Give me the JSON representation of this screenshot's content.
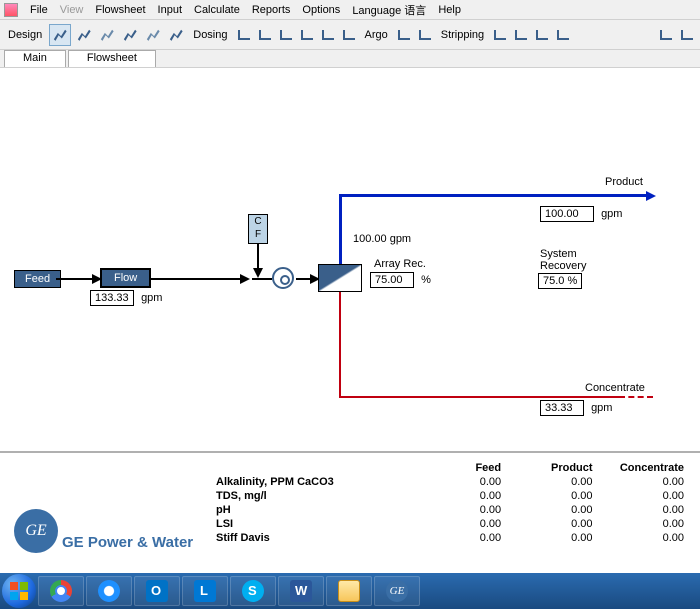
{
  "menu": {
    "file": "File",
    "view": "View",
    "flowsheet": "Flowsheet",
    "input": "Input",
    "calculate": "Calculate",
    "reports": "Reports",
    "options": "Options",
    "language": "Language 语言",
    "help": "Help"
  },
  "toolbar": {
    "design": "Design",
    "dosing": "Dosing",
    "argo": "Argo",
    "stripping": "Stripping"
  },
  "tabs": {
    "main": "Main",
    "flowsheet": "Flowsheet"
  },
  "flowsheet": {
    "feed_label": "Feed",
    "flow_label": "Flow",
    "flow_value": "133.33",
    "flow_unit": "gpm",
    "cf_label_1": "C",
    "cf_label_2": "F",
    "feed_to_membrane": "100.00 gpm",
    "array_rec_label": "Array Rec.",
    "array_rec_value": "75.00",
    "array_rec_unit": "%",
    "product_label": "Product",
    "product_value": "100.00",
    "product_unit": "gpm",
    "system_recovery_label1": "System",
    "system_recovery_label2": "Recovery",
    "system_recovery_value": "75.0 %",
    "concentrate_label": "Concentrate",
    "concentrate_value": "33.33",
    "concentrate_unit": "gpm"
  },
  "table": {
    "headers": {
      "feed": "Feed",
      "product": "Product",
      "concentrate": "Concentrate"
    },
    "rows": [
      {
        "label": "Alkalinity, PPM CaCO3",
        "feed": "0.00",
        "product": "0.00",
        "concentrate": "0.00"
      },
      {
        "label": "TDS, mg/l",
        "feed": "0.00",
        "product": "0.00",
        "concentrate": "0.00"
      },
      {
        "label": "pH",
        "feed": "0.00",
        "product": "0.00",
        "concentrate": "0.00"
      },
      {
        "label": "LSI",
        "feed": "0.00",
        "product": "0.00",
        "concentrate": "0.00"
      },
      {
        "label": "Stiff Davis",
        "feed": "0.00",
        "product": "0.00",
        "concentrate": "0.00"
      }
    ]
  },
  "branding": {
    "logo": "GE",
    "text": "GE Power & Water"
  }
}
